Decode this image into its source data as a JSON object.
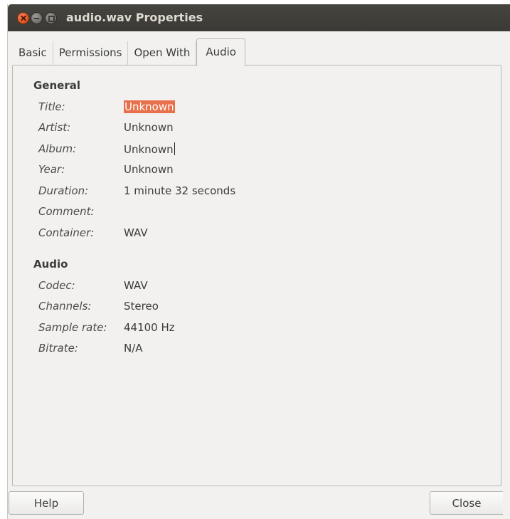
{
  "window": {
    "title": "audio.wav Properties"
  },
  "tabs": [
    {
      "label": "Basic",
      "active": false
    },
    {
      "label": "Permissions",
      "active": false
    },
    {
      "label": "Open With",
      "active": false
    },
    {
      "label": "Audio",
      "active": true
    }
  ],
  "general": {
    "heading": "General",
    "rows": [
      {
        "label": "Title:",
        "value": "Unknown"
      },
      {
        "label": "Artist:",
        "value": "Unknown"
      },
      {
        "label": "Album:",
        "value": "Unknown"
      },
      {
        "label": "Year:",
        "value": "Unknown"
      },
      {
        "label": "Duration:",
        "value": "1 minute 32 seconds"
      },
      {
        "label": "Comment:",
        "value": ""
      },
      {
        "label": "Container:",
        "value": "WAV"
      }
    ]
  },
  "audio": {
    "heading": "Audio",
    "rows": [
      {
        "label": "Codec:",
        "value": "WAV"
      },
      {
        "label": "Channels:",
        "value": "Stereo"
      },
      {
        "label": "Sample rate:",
        "value": "44100 Hz"
      },
      {
        "label": "Bitrate:",
        "value": "N/A"
      }
    ]
  },
  "buttons": {
    "help": "Help",
    "close": "Close"
  },
  "colors": {
    "selection": "#e8704a",
    "titlebar": "#3c3b37",
    "close_button": "#e85e2c"
  }
}
